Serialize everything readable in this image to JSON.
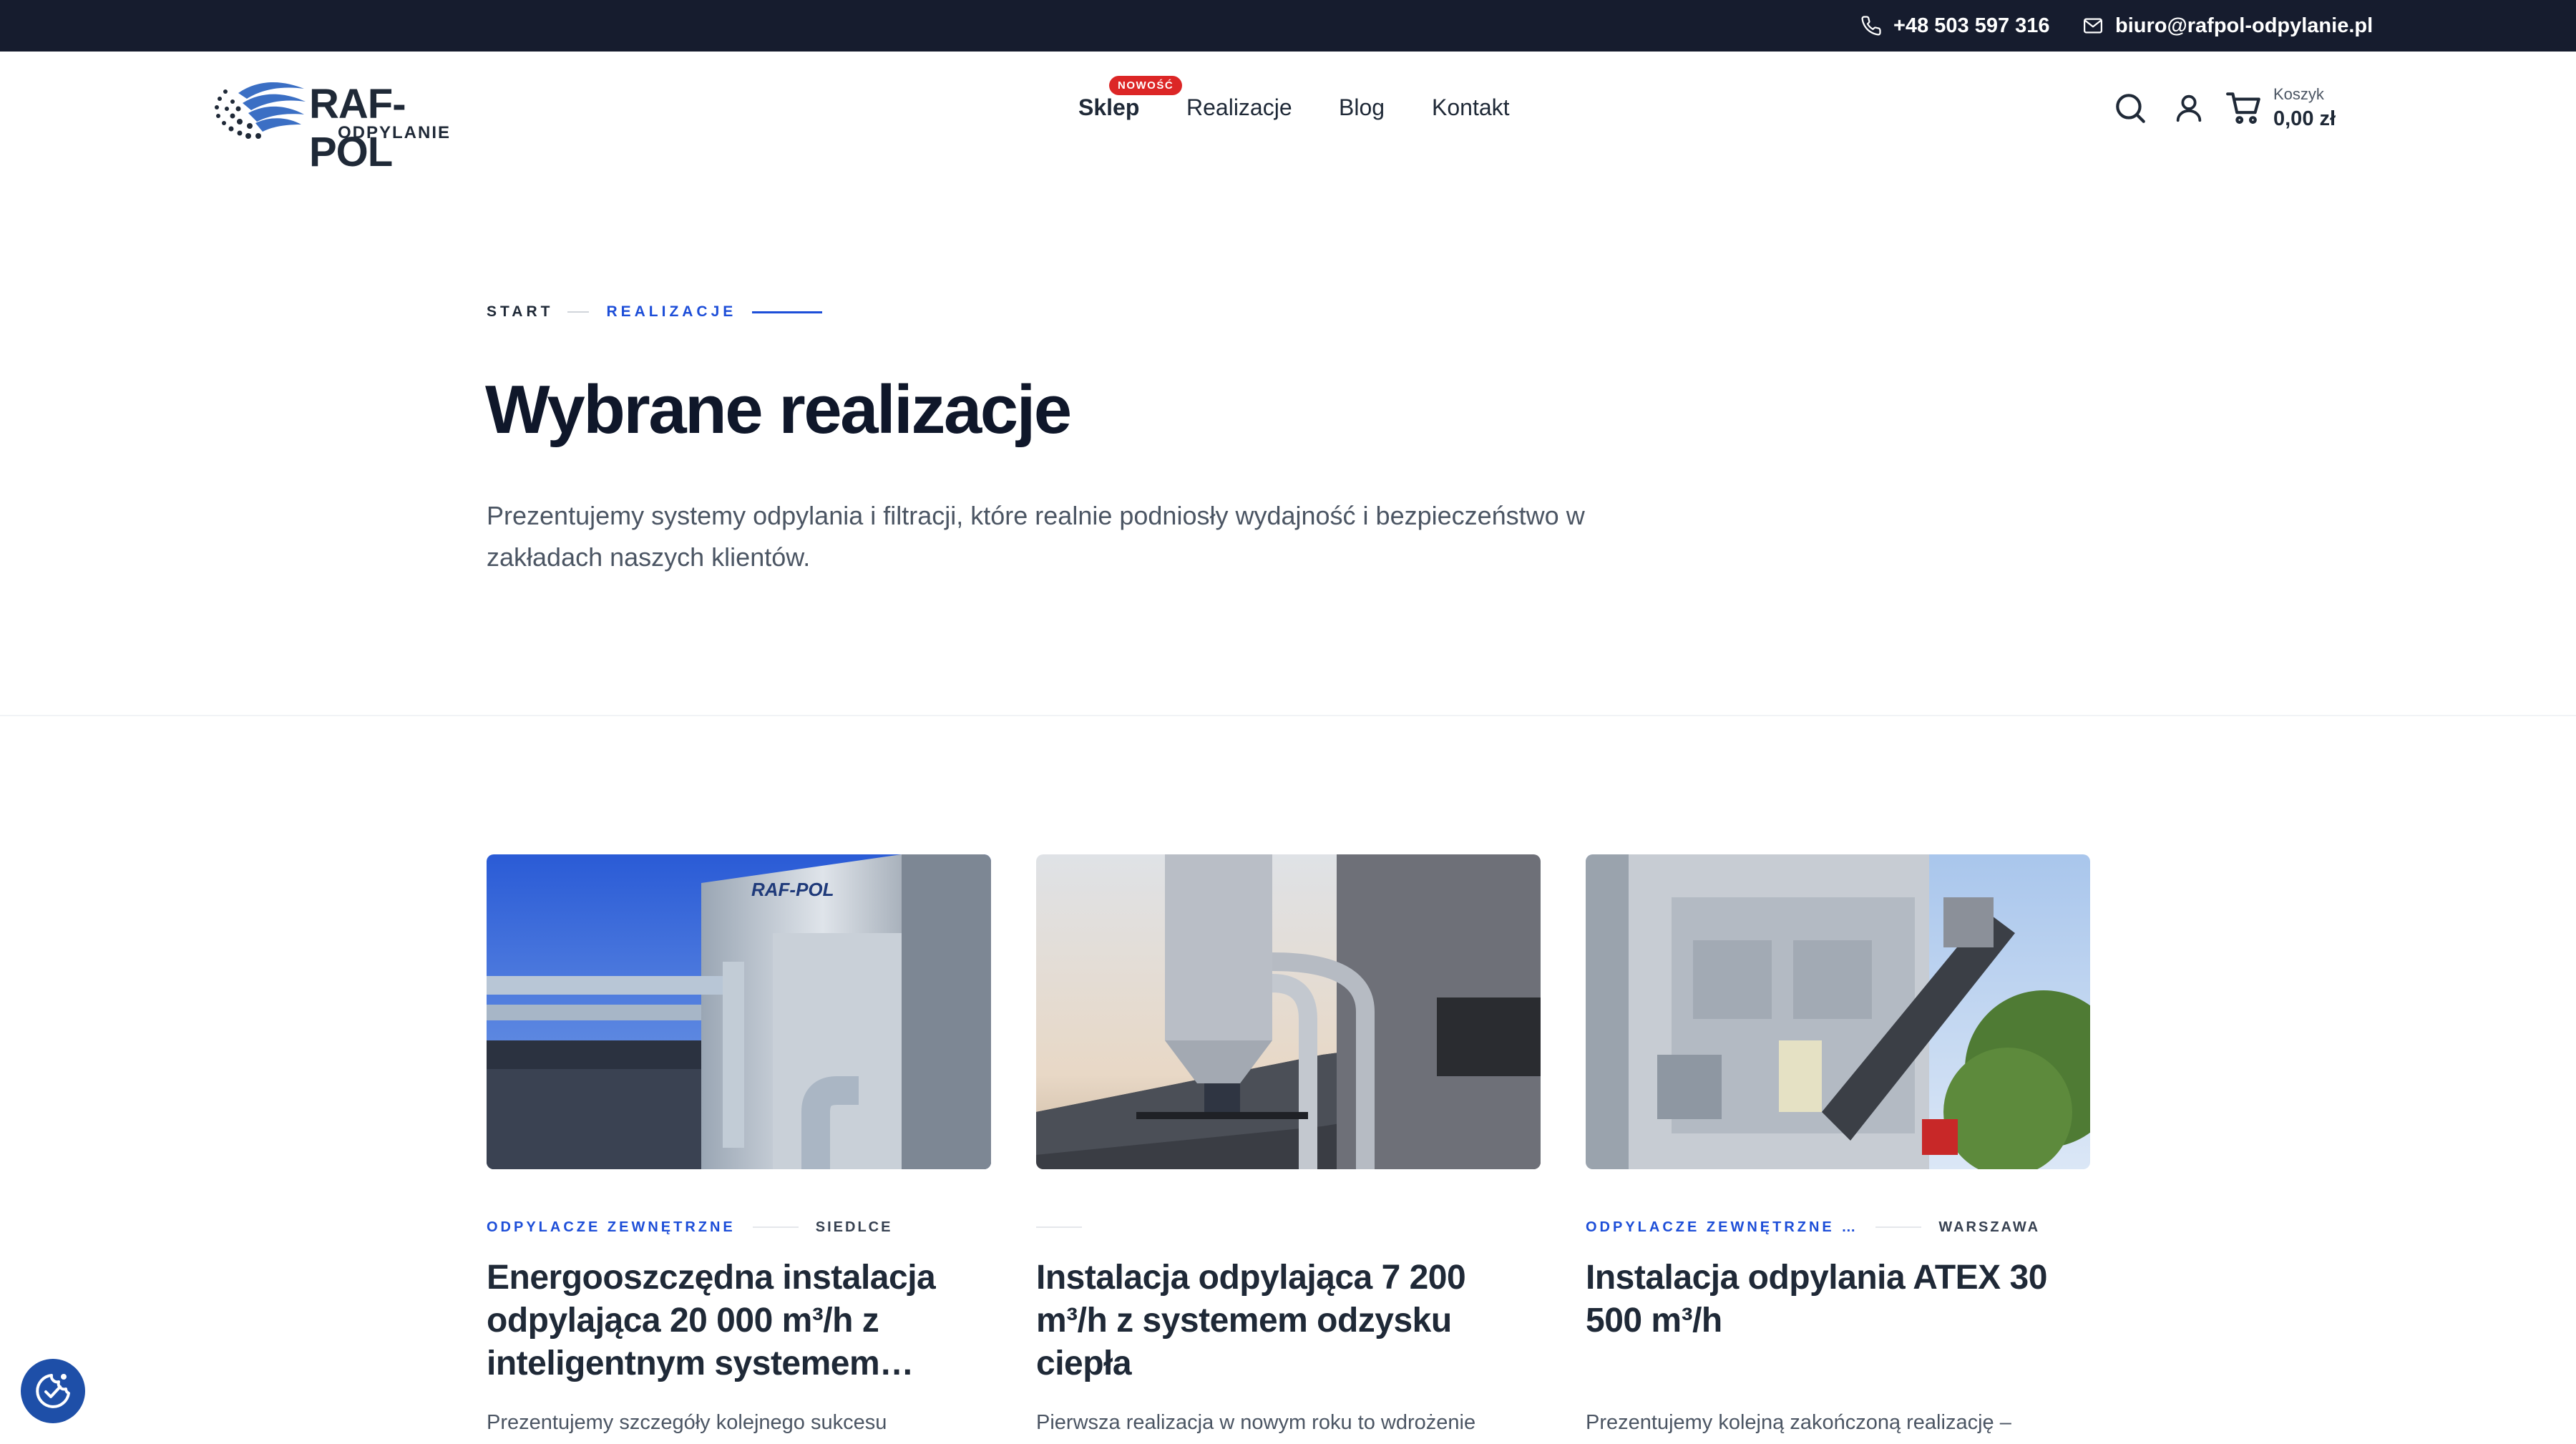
{
  "topbar": {
    "phone": "+48 503 597 316",
    "email": "biuro@rafpol-odpylanie.pl"
  },
  "header": {
    "logo_brand": "RAF-POL",
    "logo_sub": "ODPYLANIE",
    "nav": {
      "shop": "Sklep",
      "shop_badge": "NOWOŚĆ",
      "realizations": "Realizacje",
      "blog": "Blog",
      "contact": "Kontakt"
    },
    "cart_label": "Koszyk",
    "cart_total": "0,00 zł",
    "icons": [
      "search-icon",
      "user-icon",
      "cart-icon"
    ]
  },
  "breadcrumb": {
    "start": "START",
    "current": "REALIZACJE"
  },
  "hero": {
    "title": "Wybrane realizacje",
    "lead": "Prezentujemy systemy odpylania i filtracji, które realnie podniosły wydajność i bezpieczeństwo w zakładach naszych klientów."
  },
  "cards": [
    {
      "category": "ODPYLACZE ZEWNĘTRZNE",
      "location": "SIEDLCE",
      "title": "Energooszczędna instalacja odpylająca 20 000 m³/h z inteligentnym systemem…",
      "excerpt": "Prezentujemy szczegóły kolejnego sukcesu"
    },
    {
      "category": "",
      "location": "",
      "title": "Instalacja odpylająca 7 200 m³/h z systemem odzysku ciepła",
      "excerpt": "Pierwsza realizacja w nowym roku to wdrożenie"
    },
    {
      "category": "ODPYLACZE ZEWNĘTRZNE …",
      "location": "WARSZAWA",
      "title": "Instalacja odpylania ATEX 30 500 m³/h",
      "excerpt": "Prezentujemy kolejną zakończoną realizację –"
    }
  ],
  "colors": {
    "topbar_bg": "#161c2e",
    "accent": "#1d4ed8",
    "badge": "#dc2626",
    "text": "#0f172a"
  }
}
